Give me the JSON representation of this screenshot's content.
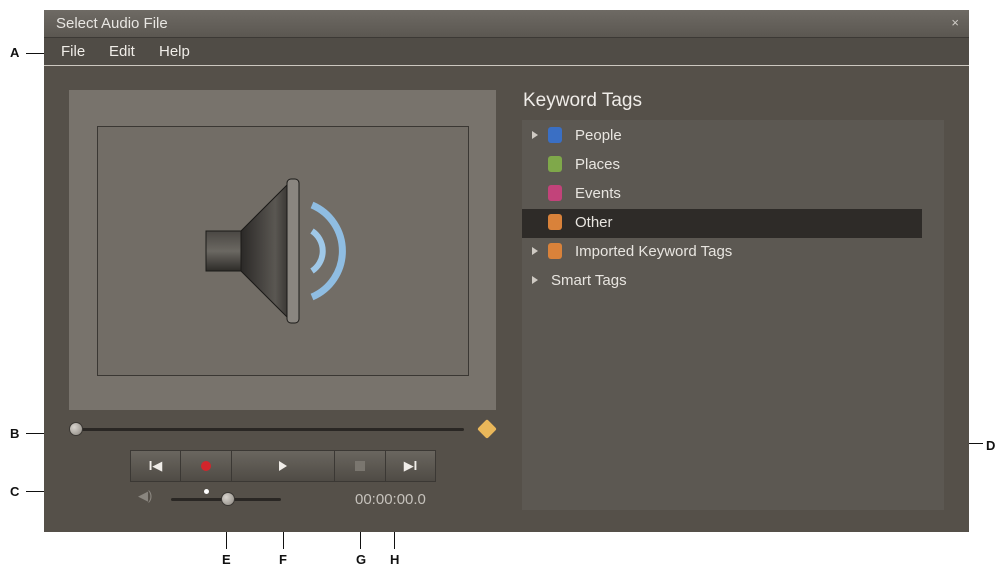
{
  "window": {
    "title": "Select Audio File",
    "close_label": "×"
  },
  "menu": [
    "File",
    "Edit",
    "Help"
  ],
  "keyword_panel": {
    "title": "Keyword Tags",
    "items": [
      {
        "label": "People",
        "icon": "people-tag-icon",
        "color": "#3a6fc4",
        "expandable": true,
        "selected": false
      },
      {
        "label": "Places",
        "icon": "places-tag-icon",
        "color": "#7fa84a",
        "expandable": false,
        "selected": false
      },
      {
        "label": "Events",
        "icon": "events-tag-icon",
        "color": "#c2437a",
        "expandable": false,
        "selected": false
      },
      {
        "label": "Other",
        "icon": "other-tag-icon",
        "color": "#d9823a",
        "expandable": false,
        "selected": true
      },
      {
        "label": "Imported Keyword Tags",
        "icon": "imported-tag-icon",
        "color": "#d9823a",
        "expandable": true,
        "selected": false
      },
      {
        "label": "Smart Tags",
        "icon": "",
        "color": "",
        "expandable": true,
        "selected": false
      }
    ]
  },
  "player": {
    "timecode": "00:00:00.0",
    "scrub_position": 0.0,
    "volume_level": 0.48,
    "buttons": [
      "previous-icon",
      "record-icon",
      "play-icon",
      "stop-icon",
      "next-icon"
    ],
    "record_color": "#d3252b"
  },
  "callouts": {
    "A": "A",
    "B": "B",
    "C": "C",
    "D": "D",
    "E": "E",
    "F": "F",
    "G": "G",
    "H": "H"
  }
}
